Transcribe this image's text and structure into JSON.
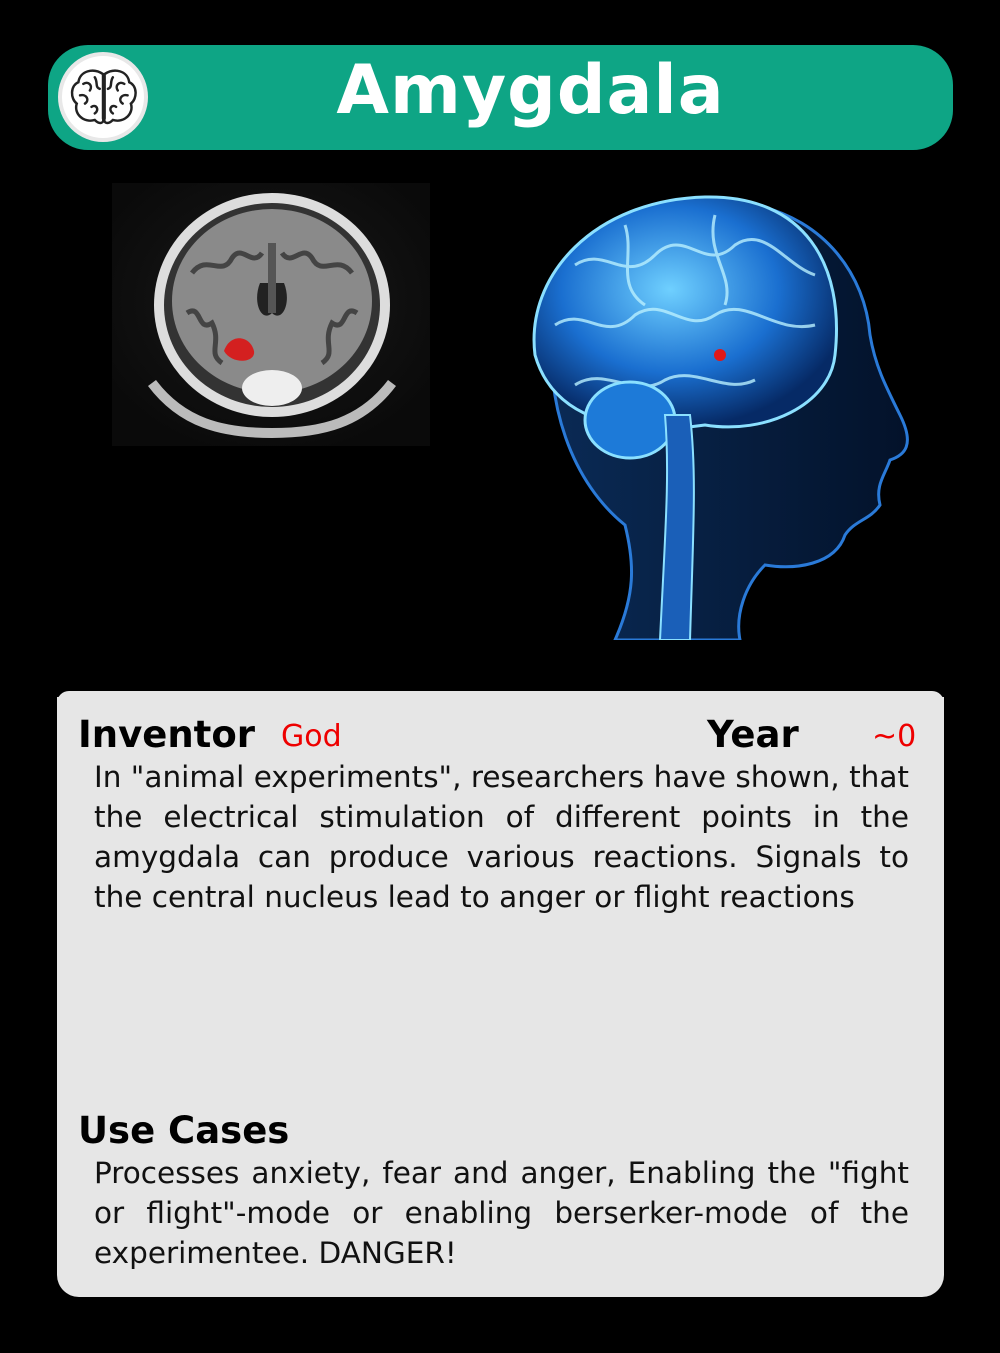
{
  "card": {
    "title": "Amygdala",
    "header_color": "#0ea585",
    "badge_icon": "brain-icon"
  },
  "images": {
    "mri": "mri-coronal-slice-with-highlighted-amygdala",
    "brain": "3d-blue-brain-head-profile-with-highlighted-amygdala"
  },
  "info": {
    "inventor_label": "Inventor",
    "inventor_value": "God",
    "year_label": "Year",
    "year_value": "~0",
    "description": "In \"animal experiments\", researchers have shown, that the electrical stimulation of different points in the amygdala can produce various reactions. Signals to the central nucleus lead to anger or flight reactions",
    "use_cases_label": "Use Cases",
    "use_cases_text": "Processes anxiety, fear and anger, Enabling the \"fight or flight\"-mode or enabling berserker-mode of the experimentee. DANGER!"
  }
}
